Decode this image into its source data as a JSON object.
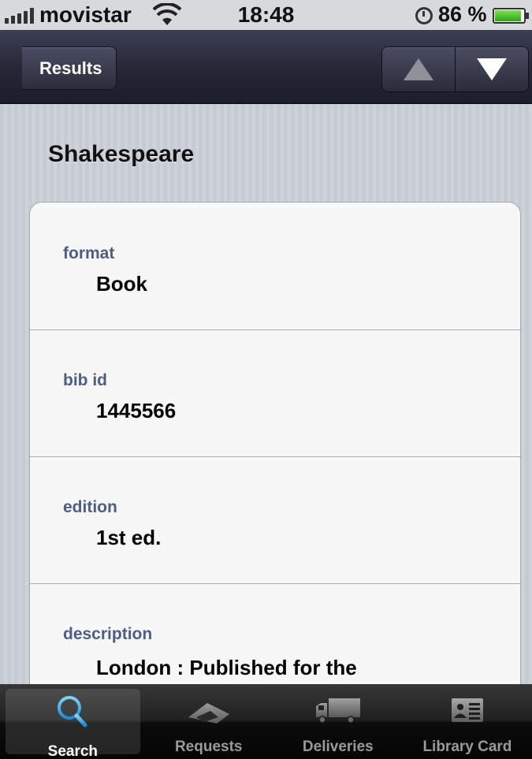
{
  "status_bar": {
    "carrier": "movistar",
    "time": "18:48",
    "battery_percent": "86 %",
    "battery_level": 0.86,
    "icons": [
      "signal-bars-icon",
      "wifi-icon",
      "alarm-clock-icon",
      "battery-icon"
    ]
  },
  "nav_bar": {
    "back_label": "Results",
    "prev_icon": "triangle-up-icon",
    "next_icon": "triangle-down-icon"
  },
  "record": {
    "title": "Shakespeare",
    "fields": [
      {
        "label": "format",
        "value": "Book"
      },
      {
        "label": "bib id",
        "value": "1445566"
      },
      {
        "label": "edition",
        "value": "1st ed."
      },
      {
        "label": "description",
        "value": "London : Published for the"
      }
    ]
  },
  "tab_bar": {
    "tabs": [
      {
        "label": "Search",
        "icon": "magnifier-icon",
        "active": true
      },
      {
        "label": "Requests",
        "icon": "requests-icon",
        "active": false
      },
      {
        "label": "Deliveries",
        "icon": "truck-icon",
        "active": false
      },
      {
        "label": "Library Card",
        "icon": "id-card-icon",
        "active": false
      }
    ]
  },
  "colors": {
    "nav_bar": "#262838",
    "field_label": "#4c5d86",
    "tab_bar": "#202020",
    "active_tab_icon": "#2ea6ea"
  }
}
